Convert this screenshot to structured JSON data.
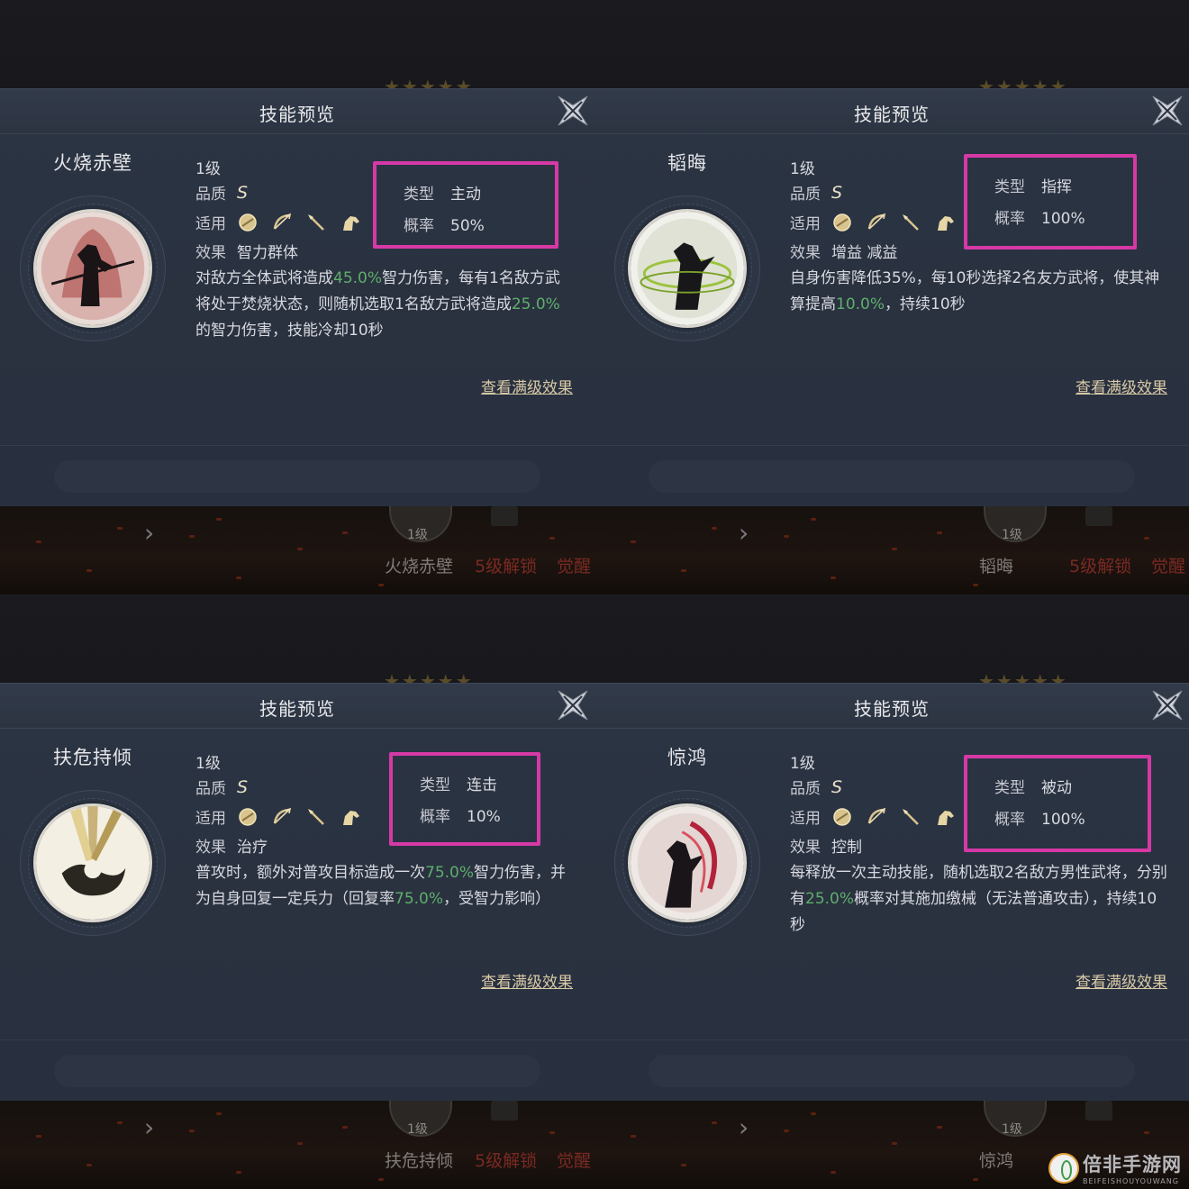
{
  "panels": [
    {
      "title": "技能预览",
      "skill_name": "火烧赤壁",
      "level": "1级",
      "quality_label": "品质",
      "quality": "S",
      "apply_label": "适用",
      "effect_label": "效果",
      "effect": "智力群体",
      "type_label": "类型",
      "type": "主动",
      "rate_label": "概率",
      "rate": "50%",
      "desc": [
        "对敌方全体武将造成",
        "45.0%",
        "智力伤害，每有1名敌方武将处于焚烧状态，则随机选取1名敌方武将造成",
        "25.0%",
        "的智力伤害，技能冷却10秒",
        "",
        ""
      ],
      "full_link": "查看满级效果",
      "bottom": {
        "level": "1级",
        "name": "火烧赤壁",
        "unlock": "5级解锁",
        "awaken": "觉醒"
      }
    },
    {
      "title": "技能预览",
      "skill_name": "韬晦",
      "level": "1级",
      "quality_label": "品质",
      "quality": "S",
      "apply_label": "适用",
      "effect_label": "效果",
      "effect": "增益  减益",
      "type_label": "类型",
      "type": "指挥",
      "rate_label": "概率",
      "rate": "100%",
      "desc": [
        "自身伤害降低35%，每10秒选择2名友方武将，使其神算提高",
        "10.0%",
        "，持续10秒",
        "",
        "",
        "",
        ""
      ],
      "full_link": "查看满级效果",
      "bottom": {
        "level": "1级",
        "name": "韬晦",
        "unlock": "5级解锁",
        "awaken": "觉醒"
      }
    },
    {
      "title": "技能预览",
      "skill_name": "扶危持倾",
      "level": "1级",
      "quality_label": "品质",
      "quality": "S",
      "apply_label": "适用",
      "effect_label": "效果",
      "effect": "治疗",
      "type_label": "类型",
      "type": "连击",
      "rate_label": "概率",
      "rate": "10%",
      "desc": [
        "普攻时，额外对普攻目标造成一次",
        "75.0%",
        "智力伤害，并为自身回复一定兵力（回复率",
        "75.0%",
        "，受智力影响）",
        "",
        ""
      ],
      "full_link": "查看满级效果",
      "bottom": {
        "level": "1级",
        "name": "扶危持倾",
        "unlock": "5级解锁",
        "awaken": "觉醒"
      }
    },
    {
      "title": "技能预览",
      "skill_name": "惊鸿",
      "level": "1级",
      "quality_label": "品质",
      "quality": "S",
      "apply_label": "适用",
      "effect_label": "效果",
      "effect": "控制",
      "type_label": "类型",
      "type": "被动",
      "rate_label": "概率",
      "rate": "100%",
      "desc": [
        "每释放一次主动技能，随机选取2名敌方男性武将，分别有",
        "25.0%",
        "概率对其施加缴械（无法普通攻击），持续10秒",
        "",
        "",
        "",
        ""
      ],
      "full_link": "查看满级效果",
      "bottom": {
        "level": "1级",
        "name": "惊鸿",
        "unlock": "",
        "awaken": ""
      }
    }
  ],
  "watermark": {
    "cn": "倍非手游网",
    "en": "BEIFEISHOUYOUWANG"
  },
  "colors": {
    "highlight_box": "#d639a6",
    "highlight_text": "#5fae6b",
    "dialog_bg": "#2b3443"
  }
}
